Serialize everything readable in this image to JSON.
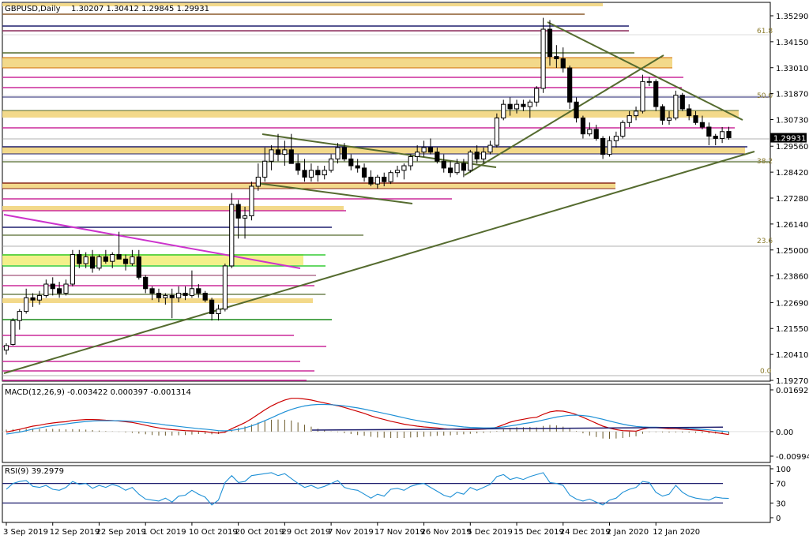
{
  "chart_data": [
    {
      "type": "candlestick",
      "title": "GBPUSD,Daily",
      "ohlc_header": "1.30207 1.30412 1.29845 1.29931",
      "last_price": "1.29931",
      "ylim": [
        1.1927,
        1.3529
      ],
      "y_ticks": [
        "1.35290",
        "1.34150",
        "1.33010",
        "1.31870",
        "1.30730",
        "1.29560",
        "1.28420",
        "1.27280",
        "1.26140",
        "1.25000",
        "1.23860",
        "1.22690",
        "1.21550",
        "1.20410",
        "1.19270"
      ],
      "x_ticks": [
        "3 Sep 2019",
        "12 Sep 2019",
        "22 Sep 2019",
        "1 Oct 2019",
        "10 Oct 2019",
        "20 Oct 2019",
        "29 Oct 2019",
        "7 Nov 2019",
        "17 Nov 2019",
        "26 Nov 2019",
        "5 Dec 2019",
        "15 Dec 2019",
        "24 Dec 2019",
        "2 Jan 2020",
        "12 Jan 2020"
      ],
      "fib_levels": [
        "61.8",
        "50.0",
        "38.2",
        "23.6",
        "0.0"
      ],
      "candles": [
        [
          1.206,
          1.209,
          1.204,
          1.208
        ],
        [
          1.2085,
          1.22,
          1.208,
          1.219
        ],
        [
          1.219,
          1.224,
          1.215,
          1.223
        ],
        [
          1.223,
          1.233,
          1.222,
          1.229
        ],
        [
          1.229,
          1.231,
          1.225,
          1.228
        ],
        [
          1.228,
          1.232,
          1.226,
          1.23
        ],
        [
          1.23,
          1.237,
          1.229,
          1.235
        ],
        [
          1.235,
          1.238,
          1.23,
          1.233
        ],
        [
          1.233,
          1.236,
          1.229,
          1.231
        ],
        [
          1.231,
          1.237,
          1.23,
          1.235
        ],
        [
          1.235,
          1.25,
          1.234,
          1.248
        ],
        [
          1.248,
          1.25,
          1.242,
          1.244
        ],
        [
          1.244,
          1.249,
          1.242,
          1.247
        ],
        [
          1.247,
          1.25,
          1.24,
          1.242
        ],
        [
          1.242,
          1.248,
          1.241,
          1.247
        ],
        [
          1.247,
          1.25,
          1.244,
          1.245
        ],
        [
          1.245,
          1.249,
          1.242,
          1.248
        ],
        [
          1.248,
          1.258,
          1.246,
          1.246
        ],
        [
          1.246,
          1.248,
          1.241,
          1.244
        ],
        [
          1.244,
          1.25,
          1.243,
          1.247
        ],
        [
          1.247,
          1.25,
          1.237,
          1.238
        ],
        [
          1.238,
          1.239,
          1.231,
          1.233
        ],
        [
          1.233,
          1.234,
          1.228,
          1.231
        ],
        [
          1.231,
          1.233,
          1.227,
          1.229
        ],
        [
          1.229,
          1.231,
          1.226,
          1.23
        ],
        [
          1.23,
          1.233,
          1.22,
          1.229
        ],
        [
          1.229,
          1.234,
          1.227,
          1.231
        ],
        [
          1.231,
          1.234,
          1.228,
          1.23
        ],
        [
          1.23,
          1.241,
          1.229,
          1.233
        ],
        [
          1.233,
          1.235,
          1.229,
          1.231
        ],
        [
          1.231,
          1.232,
          1.227,
          1.228
        ],
        [
          1.228,
          1.229,
          1.219,
          1.222
        ],
        [
          1.222,
          1.226,
          1.219,
          1.224
        ],
        [
          1.224,
          1.244,
          1.223,
          1.243
        ],
        [
          1.243,
          1.275,
          1.242,
          1.27
        ],
        [
          1.27,
          1.272,
          1.255,
          1.264
        ],
        [
          1.264,
          1.269,
          1.255,
          1.265
        ],
        [
          1.265,
          1.28,
          1.263,
          1.278
        ],
        [
          1.278,
          1.288,
          1.276,
          1.282
        ],
        [
          1.282,
          1.295,
          1.28,
          1.289
        ],
        [
          1.289,
          1.296,
          1.285,
          1.294
        ],
        [
          1.294,
          1.301,
          1.289,
          1.292
        ],
        [
          1.292,
          1.298,
          1.287,
          1.294
        ],
        [
          1.294,
          1.301,
          1.288,
          1.288
        ],
        [
          1.288,
          1.292,
          1.283,
          1.285
        ],
        [
          1.285,
          1.29,
          1.28,
          1.282
        ],
        [
          1.282,
          1.288,
          1.28,
          1.285
        ],
        [
          1.285,
          1.287,
          1.28,
          1.283
        ],
        [
          1.283,
          1.287,
          1.281,
          1.285
        ],
        [
          1.285,
          1.292,
          1.284,
          1.29
        ],
        [
          1.29,
          1.297,
          1.288,
          1.295
        ],
        [
          1.295,
          1.297,
          1.289,
          1.29
        ],
        [
          1.29,
          1.292,
          1.285,
          1.287
        ],
        [
          1.287,
          1.29,
          1.284,
          1.286
        ],
        [
          1.286,
          1.288,
          1.28,
          1.282
        ],
        [
          1.282,
          1.285,
          1.278,
          1.279
        ],
        [
          1.279,
          1.283,
          1.277,
          1.282
        ],
        [
          1.282,
          1.284,
          1.278,
          1.28
        ],
        [
          1.28,
          1.285,
          1.279,
          1.284
        ],
        [
          1.284,
          1.287,
          1.282,
          1.285
        ],
        [
          1.285,
          1.288,
          1.281,
          1.287
        ],
        [
          1.287,
          1.292,
          1.285,
          1.291
        ],
        [
          1.291,
          1.296,
          1.289,
          1.293
        ],
        [
          1.293,
          1.298,
          1.291,
          1.295
        ],
        [
          1.295,
          1.299,
          1.292,
          1.293
        ],
        [
          1.293,
          1.295,
          1.288,
          1.289
        ],
        [
          1.289,
          1.292,
          1.284,
          1.286
        ],
        [
          1.286,
          1.289,
          1.282,
          1.284
        ],
        [
          1.284,
          1.29,
          1.283,
          1.288
        ],
        [
          1.288,
          1.29,
          1.282,
          1.285
        ],
        [
          1.285,
          1.294,
          1.284,
          1.293
        ],
        [
          1.293,
          1.296,
          1.288,
          1.29
        ],
        [
          1.29,
          1.295,
          1.288,
          1.293
        ],
        [
          1.293,
          1.298,
          1.292,
          1.296
        ],
        [
          1.296,
          1.31,
          1.295,
          1.308
        ],
        [
          1.308,
          1.316,
          1.307,
          1.314
        ],
        [
          1.314,
          1.317,
          1.309,
          1.312
        ],
        [
          1.312,
          1.316,
          1.31,
          1.314
        ],
        [
          1.314,
          1.316,
          1.311,
          1.313
        ],
        [
          1.313,
          1.316,
          1.308,
          1.315
        ],
        [
          1.315,
          1.322,
          1.313,
          1.321
        ],
        [
          1.321,
          1.352,
          1.319,
          1.347
        ],
        [
          1.347,
          1.351,
          1.331,
          1.335
        ],
        [
          1.335,
          1.34,
          1.33,
          1.334
        ],
        [
          1.334,
          1.339,
          1.328,
          1.33
        ],
        [
          1.33,
          1.331,
          1.312,
          1.315
        ],
        [
          1.315,
          1.317,
          1.306,
          1.308
        ],
        [
          1.308,
          1.309,
          1.299,
          1.301
        ],
        [
          1.301,
          1.306,
          1.3,
          1.303
        ],
        [
          1.303,
          1.305,
          1.298,
          1.299
        ],
        [
          1.299,
          1.3,
          1.29,
          1.292
        ],
        [
          1.292,
          1.3,
          1.291,
          1.298
        ],
        [
          1.298,
          1.302,
          1.295,
          1.3
        ],
        [
          1.3,
          1.307,
          1.299,
          1.306
        ],
        [
          1.306,
          1.311,
          1.304,
          1.309
        ],
        [
          1.309,
          1.313,
          1.307,
          1.311
        ],
        [
          1.311,
          1.327,
          1.31,
          1.324
        ],
        [
          1.324,
          1.326,
          1.322,
          1.324
        ],
        [
          1.324,
          1.325,
          1.311,
          1.313
        ],
        [
          1.313,
          1.314,
          1.305,
          1.307
        ],
        [
          1.307,
          1.311,
          1.305,
          1.308
        ],
        [
          1.308,
          1.32,
          1.307,
          1.318
        ],
        [
          1.318,
          1.319,
          1.311,
          1.312
        ],
        [
          1.312,
          1.314,
          1.307,
          1.309
        ],
        [
          1.309,
          1.311,
          1.305,
          1.306
        ],
        [
          1.306,
          1.309,
          1.303,
          1.304
        ],
        [
          1.304,
          1.306,
          1.296,
          1.3
        ],
        [
          1.3,
          1.301,
          1.296,
          1.299
        ],
        [
          1.299,
          1.304,
          1.297,
          1.302
        ],
        [
          1.30207,
          1.30412,
          1.29845,
          1.29931
        ]
      ]
    },
    {
      "type": "line",
      "title": "MACD(12,26,9) -0.003422 0.000397 -0.001314",
      "y_ticks": [
        "0.016925",
        "0.00",
        "-0.009949"
      ],
      "ylim": [
        -0.009949,
        0.016925
      ],
      "series": [
        {
          "name": "main",
          "values": [
            -0.0002,
            0.0004,
            0.0009,
            0.0016,
            0.0022,
            0.0026,
            0.0031,
            0.0035,
            0.0038,
            0.004,
            0.0045,
            0.0047,
            0.0049,
            0.0049,
            0.0048,
            0.0046,
            0.0045,
            0.0043,
            0.004,
            0.0037,
            0.0032,
            0.0026,
            0.002,
            0.0015,
            0.0011,
            0.0008,
            0.0006,
            0.0004,
            0.0003,
            0.0002,
            0.0,
            -0.0004,
            -0.0006,
            -0.0002,
            0.0012,
            0.0024,
            0.0036,
            0.0052,
            0.007,
            0.0088,
            0.0104,
            0.0117,
            0.0128,
            0.0135,
            0.0135,
            0.0132,
            0.0128,
            0.0122,
            0.0116,
            0.011,
            0.0105,
            0.0098,
            0.009,
            0.0082,
            0.0074,
            0.0064,
            0.0056,
            0.0049,
            0.0042,
            0.0036,
            0.003,
            0.0026,
            0.0022,
            0.0019,
            0.0017,
            0.0015,
            0.0012,
            0.001,
            0.0009,
            0.0008,
            0.0008,
            0.0009,
            0.001,
            0.0012,
            0.0018,
            0.0028,
            0.0038,
            0.0045,
            0.005,
            0.0055,
            0.0058,
            0.007,
            0.008,
            0.0084,
            0.0083,
            0.0077,
            0.0069,
            0.0058,
            0.0046,
            0.0034,
            0.0022,
            0.0014,
            0.0008,
            0.0004,
            0.0003,
            0.0002,
            0.001,
            0.0016,
            0.0016,
            0.0014,
            0.0012,
            0.0012,
            0.001,
            0.0008,
            0.0006,
            0.0004,
            0.0,
            -0.0004,
            -0.0008,
            -0.0012
          ]
        },
        {
          "name": "signal",
          "values": [
            -0.001,
            -0.0006,
            -0.0002,
            0.0004,
            0.001,
            0.0015,
            0.002,
            0.0024,
            0.0028,
            0.0031,
            0.0035,
            0.0038,
            0.0041,
            0.0043,
            0.0044,
            0.0044,
            0.0044,
            0.0044,
            0.0043,
            0.0042,
            0.004,
            0.0037,
            0.0034,
            0.0031,
            0.0027,
            0.0024,
            0.0021,
            0.0018,
            0.0015,
            0.0012,
            0.001,
            0.0007,
            0.0004,
            0.0003,
            0.0005,
            0.0009,
            0.0015,
            0.0023,
            0.0033,
            0.0044,
            0.0056,
            0.0068,
            0.008,
            0.009,
            0.0098,
            0.0104,
            0.0108,
            0.011,
            0.011,
            0.0109,
            0.0107,
            0.0104,
            0.01,
            0.0096,
            0.0091,
            0.0085,
            0.008,
            0.0074,
            0.0068,
            0.0062,
            0.0056,
            0.005,
            0.0045,
            0.004,
            0.0036,
            0.0032,
            0.0028,
            0.0025,
            0.0022,
            0.0019,
            0.0017,
            0.0016,
            0.0015,
            0.0015,
            0.0016,
            0.0019,
            0.0023,
            0.0027,
            0.0032,
            0.0036,
            0.0041,
            0.0047,
            0.0053,
            0.0059,
            0.0063,
            0.0066,
            0.0067,
            0.0065,
            0.0062,
            0.0056,
            0.005,
            0.0043,
            0.0036,
            0.003,
            0.0025,
            0.0021,
            0.0019,
            0.0018,
            0.0018,
            0.0017,
            0.0016,
            0.0015,
            0.0014,
            0.0012,
            0.0011,
            0.0009,
            0.0007,
            0.0004,
            0.0002,
            -0.0001
          ]
        }
      ],
      "histogram": [
        0.0008,
        0.001,
        0.0011,
        0.0012,
        0.0012,
        0.0011,
        0.0011,
        0.0011,
        0.001,
        0.0009,
        0.001,
        0.0009,
        0.0008,
        0.0006,
        0.0004,
        0.0002,
        0.0001,
        -0.0001,
        -0.0003,
        -0.0005,
        -0.0008,
        -0.0011,
        -0.0014,
        -0.0016,
        -0.0016,
        -0.0016,
        -0.0015,
        -0.0014,
        -0.0012,
        -0.001,
        -0.001,
        -0.0011,
        -0.001,
        -0.0005,
        0.0007,
        0.0015,
        0.0021,
        0.0029,
        0.0037,
        0.0044,
        0.0048,
        0.0049,
        0.0048,
        0.0045,
        0.0037,
        0.0028,
        0.002,
        0.0012,
        0.0006,
        0.0001,
        -0.0002,
        -0.0006,
        -0.001,
        -0.0014,
        -0.0017,
        -0.0021,
        -0.0024,
        -0.0025,
        -0.0026,
        -0.0026,
        -0.0026,
        -0.0024,
        -0.0023,
        -0.0021,
        -0.0019,
        -0.0017,
        -0.0016,
        -0.0015,
        -0.0013,
        -0.0011,
        -0.0009,
        -0.0007,
        -0.0005,
        -0.0003,
        0.0002,
        0.0009,
        0.0015,
        0.0018,
        0.0018,
        0.0019,
        0.0017,
        0.0023,
        0.0027,
        0.0025,
        0.002,
        0.0011,
        0.0002,
        -0.0007,
        -0.0016,
        -0.0022,
        -0.0028,
        -0.0029,
        -0.0028,
        -0.0026,
        -0.0022,
        -0.0019,
        -0.0009,
        -0.0002,
        -0.0002,
        -0.0003,
        -0.0004,
        -0.0003,
        -0.0004,
        -0.0004,
        -0.0005,
        -0.0005,
        -0.0007,
        -0.0008,
        -0.001,
        -0.0011
      ]
    },
    {
      "type": "line",
      "title": "RSI(9) 39.2979",
      "y_ticks": [
        "100",
        "70",
        "30",
        "0"
      ],
      "ylim": [
        0,
        100
      ],
      "levels": [
        70,
        30
      ],
      "series": [
        {
          "name": "RSI",
          "values": [
            58,
            70,
            74,
            76,
            64,
            62,
            66,
            58,
            56,
            62,
            74,
            68,
            70,
            60,
            66,
            62,
            68,
            64,
            56,
            62,
            48,
            38,
            36,
            34,
            40,
            32,
            44,
            46,
            56,
            48,
            42,
            26,
            36,
            72,
            86,
            72,
            74,
            86,
            88,
            90,
            92,
            86,
            90,
            80,
            70,
            62,
            66,
            60,
            64,
            70,
            76,
            62,
            58,
            56,
            48,
            40,
            48,
            44,
            58,
            60,
            56,
            64,
            68,
            70,
            62,
            54,
            46,
            42,
            52,
            48,
            62,
            56,
            62,
            68,
            84,
            88,
            78,
            82,
            78,
            84,
            88,
            92,
            72,
            70,
            66,
            46,
            38,
            34,
            38,
            32,
            26,
            36,
            40,
            52,
            58,
            62,
            74,
            72,
            52,
            44,
            48,
            66,
            52,
            44,
            40,
            38,
            36,
            42,
            40,
            39.3
          ]
        }
      ]
    }
  ]
}
